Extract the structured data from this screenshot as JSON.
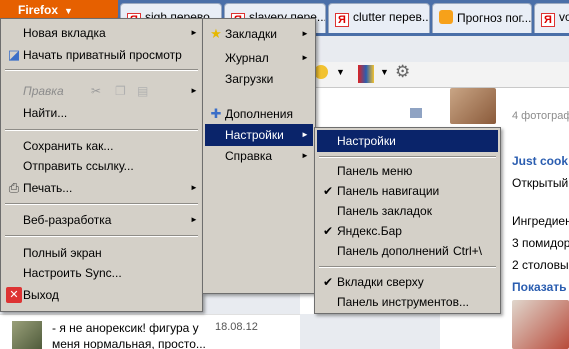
{
  "browser": {
    "button_label": "Firefox",
    "tabs": [
      {
        "label": "sigh перево..."
      },
      {
        "label": "slavery пере..."
      },
      {
        "label": "clutter перев..."
      },
      {
        "label": "Прогноз пог..."
      },
      {
        "label": "voi"
      }
    ]
  },
  "page": {
    "photos_label": "4 фотограф",
    "recipe_title": "Just cook!",
    "recipe_line1": "Открытый",
    "ingredients": "Ингредиен",
    "line_tomato": "3 помидора",
    "line_spoons": "2 столовы",
    "show_more": "Показать",
    "post_text_1": "- я не анорексик! фигура у",
    "post_text_2": "меня нормальная, просто...",
    "post_date": "18.08.12"
  },
  "menu_main": {
    "items": [
      {
        "label": "Новая вкладка"
      },
      {
        "label": "Начать приватный просмотр"
      },
      {
        "label": "Правка"
      },
      {
        "label": "Найти..."
      },
      {
        "label": "Сохранить как..."
      },
      {
        "label": "Отправить ссылку..."
      },
      {
        "label": "Печать..."
      },
      {
        "label": "Веб-разработка"
      },
      {
        "label": "Полный экран"
      },
      {
        "label": "Настроить Sync..."
      },
      {
        "label": "Выход"
      }
    ]
  },
  "menu_second": {
    "items": [
      {
        "label": "Закладки"
      },
      {
        "label": "Журнал"
      },
      {
        "label": "Загрузки"
      },
      {
        "label": "Дополнения"
      },
      {
        "label": "Настройки"
      },
      {
        "label": "Справка"
      }
    ]
  },
  "menu_settings": {
    "items": [
      {
        "label": "Настройки"
      },
      {
        "label": "Панель меню"
      },
      {
        "label": "Панель навигации"
      },
      {
        "label": "Панель закладок"
      },
      {
        "label": "Яндекс.Бар"
      },
      {
        "label": "Панель дополнений",
        "shortcut": "Ctrl+\\"
      },
      {
        "label": "Вкладки сверху"
      },
      {
        "label": "Панель инструментов..."
      }
    ]
  },
  "colors": {
    "firefox_orange": "#e66000",
    "highlight": "#0a246a",
    "menu_bg": "#d4d0c8",
    "link_blue": "#2a5db0"
  }
}
